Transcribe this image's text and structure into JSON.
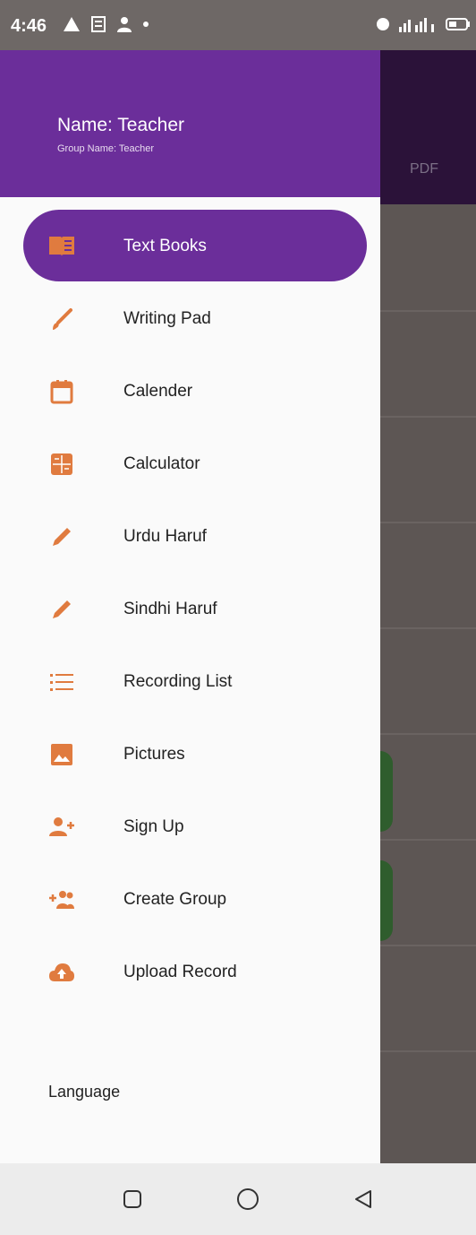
{
  "status_bar": {
    "time": "4:46"
  },
  "background": {
    "header_label": "PDF"
  },
  "drawer": {
    "header": {
      "name": "Name: Teacher",
      "group": "Group Name: Teacher"
    },
    "items": [
      {
        "label": "Text Books",
        "icon": "book-icon",
        "active": true
      },
      {
        "label": "Writing Pad",
        "icon": "brush-icon"
      },
      {
        "label": "Calender",
        "icon": "calendar-icon"
      },
      {
        "label": "Calculator",
        "icon": "calculator-icon"
      },
      {
        "label": "Urdu Haruf",
        "icon": "pencil-icon"
      },
      {
        "label": "Sindhi Haruf",
        "icon": "pencil-icon"
      },
      {
        "label": "Recording List",
        "icon": "list-icon"
      },
      {
        "label": "Pictures",
        "icon": "image-icon"
      },
      {
        "label": "Sign Up",
        "icon": "person-add-icon"
      },
      {
        "label": "Create Group",
        "icon": "group-add-icon"
      },
      {
        "label": "Upload Record",
        "icon": "cloud-upload-icon"
      }
    ],
    "language_label": "Language"
  },
  "colors": {
    "accent": "#6B2E9A",
    "icon": "#E07B3F",
    "drawer_bg": "#FAFAFA"
  }
}
